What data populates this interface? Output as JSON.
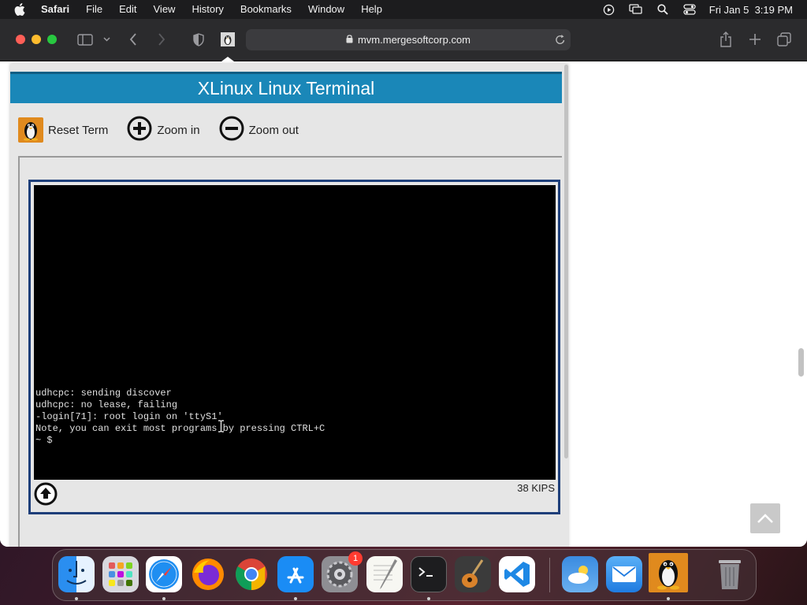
{
  "menubar": {
    "app_name": "Safari",
    "menus": [
      "File",
      "Edit",
      "View",
      "History",
      "Bookmarks",
      "Window",
      "Help"
    ],
    "clock": "Fri Jan 5  3:19 PM",
    "status_icons": [
      "play-circle-icon",
      "screen-mirroring-icon",
      "spotlight-search-icon",
      "control-center-icon"
    ]
  },
  "browser": {
    "url": "mvm.mergesoftcorp.com",
    "toolbar_icons": [
      "sidebar-icon",
      "chevron-down-icon",
      "back-icon",
      "forward-icon",
      "privacy-shield-icon",
      "site-favicon",
      "lock-icon",
      "reload-icon",
      "share-icon",
      "new-tab-icon",
      "tab-overview-icon"
    ]
  },
  "emulator": {
    "title": "XLinux Linux Terminal",
    "controls": {
      "reset_label": "Reset Term",
      "zoom_in_label": "Zoom in",
      "zoom_out_label": "Zoom out"
    },
    "terminal_lines": [
      "udhcpc: sending discover",
      "udhcpc: no lease, failing",
      "-login[71]: root login on 'ttyS1'",
      "Note, you can exit most programs by pressing CTRL+C",
      "~ $"
    ],
    "speed": "38 KIPS"
  },
  "dock": {
    "apps": [
      "Finder",
      "Launchpad",
      "Safari",
      "Firefox",
      "Google Chrome",
      "App Store",
      "System Settings",
      "TextEdit",
      "Terminal",
      "GarageBand",
      "Visual Studio Code",
      "Weather",
      "Mail",
      "XLinux"
    ],
    "system_settings_badge": "1"
  },
  "colors": {
    "title_bar": "#1a87b8",
    "terminal_border": "#1e3f7a",
    "terminal_bg": "#000000",
    "tux_orange": "#e08a1e"
  }
}
